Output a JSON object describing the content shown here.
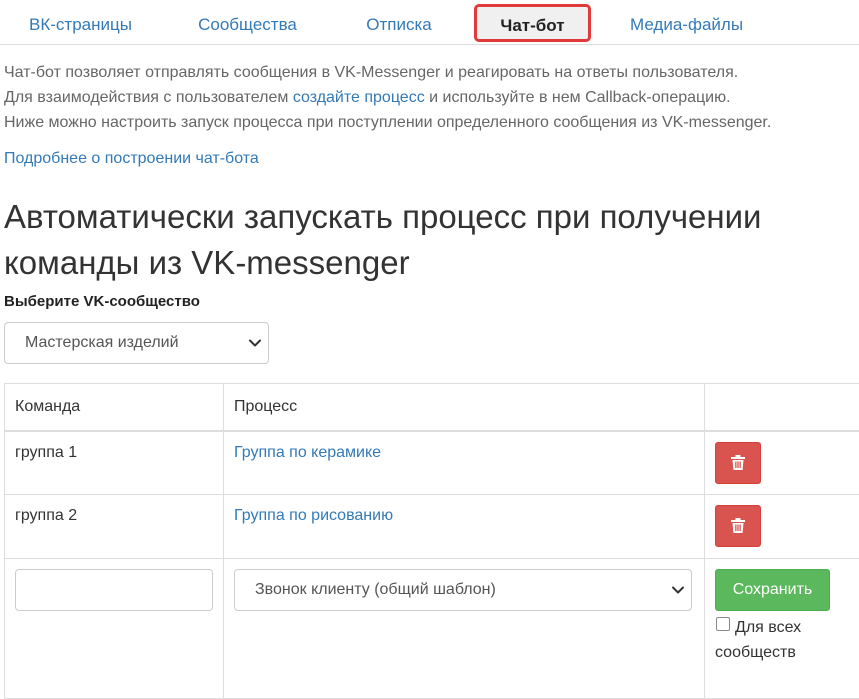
{
  "tabs": [
    {
      "label": "ВК-страницы",
      "active": false
    },
    {
      "label": "Сообщества",
      "active": false
    },
    {
      "label": "Отписка",
      "active": false
    },
    {
      "label": "Чат-бот",
      "active": true
    },
    {
      "label": "Медиа-файлы",
      "active": false
    }
  ],
  "intro": {
    "line1": "Чат-бот позволяет отправлять сообщения в VK-Messenger и реагировать на ответы пользователя.",
    "line2_before": "Для взаимодействия с пользователем ",
    "line2_link": "создайте процесс",
    "line2_after": " и используйте в нем Callback-операцию.",
    "line3": "Ниже можно настроить запуск процесса при поступлении определенного сообщения из VK-messenger."
  },
  "more_link": "Подробнее о построении чат-бота",
  "heading": {
    "line1": "Автоматически запускать процесс при получении",
    "line2": "команды из VK-messenger"
  },
  "community": {
    "label": "Выберите VK-сообщество",
    "selected": "Мастерская изделий"
  },
  "table": {
    "headers": [
      "Команда",
      "Процесс",
      ""
    ],
    "rows": [
      {
        "command": "группа 1",
        "process": "Группа по керамике"
      },
      {
        "command": "группа 2",
        "process": "Группа по рисованию"
      }
    ],
    "new_row": {
      "command_value": "",
      "process_selected": "Звонок клиенту (общий шаблон)",
      "save_label": "Сохранить",
      "all_communities_label": "Для всех сообществ",
      "all_communities_checked": false
    }
  },
  "icons": {
    "delete": "trash-icon",
    "dropdown": "chevron-down-icon",
    "checkbox": "checkbox-icon"
  },
  "colors": {
    "link": "#337ab7",
    "active_tab_border": "#e03a3a",
    "danger": "#d9534f",
    "success": "#5cb85c"
  }
}
